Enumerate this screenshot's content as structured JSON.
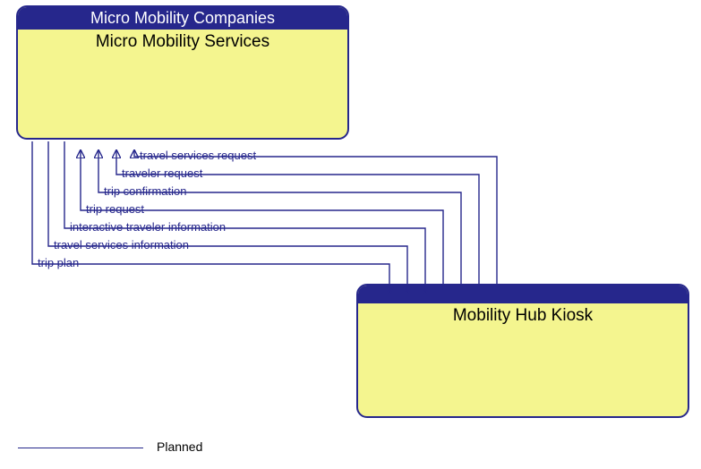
{
  "nodes": {
    "source": {
      "header": "Micro Mobility Companies",
      "title": "Micro Mobility Services"
    },
    "target": {
      "header": "",
      "title": "Mobility Hub Kiosk"
    }
  },
  "flows": [
    {
      "label": "travel services request",
      "direction": "to_source"
    },
    {
      "label": "traveler request",
      "direction": "to_source"
    },
    {
      "label": "trip confirmation",
      "direction": "to_source"
    },
    {
      "label": "trip request",
      "direction": "to_source"
    },
    {
      "label": "interactive traveler information",
      "direction": "to_target"
    },
    {
      "label": "travel services information",
      "direction": "to_target"
    },
    {
      "label": "trip plan",
      "direction": "to_target"
    }
  ],
  "legend": {
    "label": "Planned"
  },
  "colors": {
    "line": "#26278c",
    "header_bg": "#26278c",
    "header_fg": "#ffffff",
    "node_bg": "#f4f58f"
  }
}
